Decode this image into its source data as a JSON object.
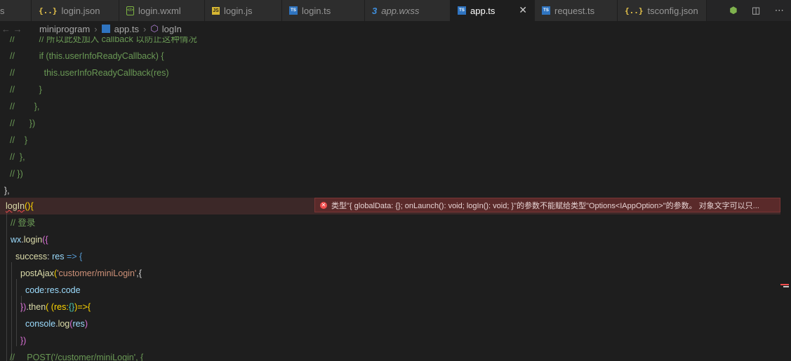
{
  "tabs": [
    {
      "label": "s",
      "icon": "none",
      "active": false,
      "width": 45
    },
    {
      "label": "login.json",
      "icon": "json",
      "active": false,
      "width": 125
    },
    {
      "label": "login.wxml",
      "icon": "wxml",
      "active": false,
      "width": 122
    },
    {
      "label": "login.js",
      "icon": "js",
      "active": false,
      "width": 110
    },
    {
      "label": "login.ts",
      "icon": "ts",
      "active": false,
      "width": 118
    },
    {
      "label": "app.wxss",
      "icon": "css",
      "active": false,
      "italic": true,
      "width": 122
    },
    {
      "label": "app.ts",
      "icon": "ts",
      "active": true,
      "width": 120
    },
    {
      "label": "request.ts",
      "icon": "ts",
      "active": false,
      "width": 118
    },
    {
      "label": "tsconfig.json",
      "icon": "json",
      "active": false,
      "width": 127
    }
  ],
  "breadcrumb": {
    "folder": "miniprogram",
    "file": "app.ts",
    "symbol": "logIn"
  },
  "diagnostic": {
    "message": "类型\"{ globalData: {}; onLaunch(): void; logIn(): void; }\"的参数不能赋给类型\"Options<IAppOption>\"的参数。 对象文字可以只..."
  },
  "code": {
    "l0": "//          // 所以此处加入 callback 以防止这种情况",
    "l1a": "//          ",
    "l1b": "if (this.userInfoReadyCallback) {",
    "l2a": "//            ",
    "l2b": "this.userInfoReadyCallback(res)",
    "l3": "//          }",
    "l4": "//        },",
    "l5": "//      })",
    "l6": "//    }",
    "l7": "//  },",
    "l8": "// })",
    "l9": "},",
    "l10_fn": "logIn",
    "l10_paren": "()",
    "l10_brace": "{",
    "l11": "// 登录",
    "l12_obj": "wx",
    "l12_fn": "login",
    "l12_rest": "({",
    "l13_prop": "success",
    "l13_p": "res",
    "l13_arrow": " => ",
    "l13_brace": "{",
    "l14_fn": "postAjax",
    "l14_str": "'customer/miniLogin'",
    "l14_rest": ",{",
    "l15_prop": "code",
    "l15_obj": "res",
    "l15_field": "code",
    "l16_a": "})",
    "l16_fn": "then",
    "l16_b": "( (res:",
    "l16_c": "{}",
    "l16_d": ")=>{",
    "l17_obj": "console",
    "l17_fn": "log",
    "l17_arg": "res",
    "l18": "})",
    "l19": "//     POST('/customer/miniLogin', {"
  }
}
